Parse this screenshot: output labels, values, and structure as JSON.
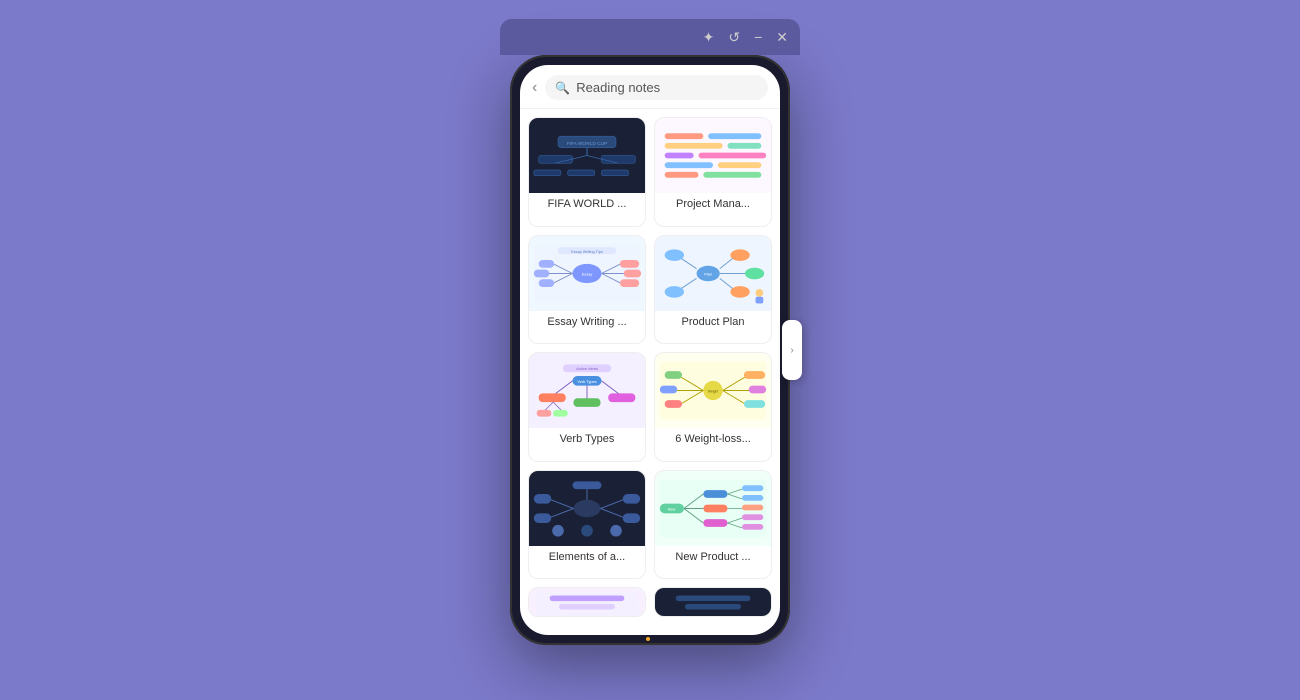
{
  "background_color": "#7b79c9",
  "titlebar": {
    "icons": [
      "star",
      "refresh",
      "minimize",
      "close"
    ],
    "bg_color": "#5c5a9e"
  },
  "search": {
    "placeholder": "Reading notes",
    "back_label": "‹"
  },
  "cards": [
    {
      "id": "fifa",
      "label": "FIFA WORLD ...",
      "theme": "dark"
    },
    {
      "id": "project-mana",
      "label": "Project Mana...",
      "theme": "light"
    },
    {
      "id": "essay-writing",
      "label": "Essay Writing ...",
      "theme": "light-blue"
    },
    {
      "id": "product-plan",
      "label": "Product Plan",
      "theme": "light-blue2"
    },
    {
      "id": "verb-types",
      "label": "Verb Types",
      "theme": "purple"
    },
    {
      "id": "weight-loss",
      "label": "6 Weight-loss...",
      "theme": "yellow"
    },
    {
      "id": "elements",
      "label": "Elements of a...",
      "theme": "dark"
    },
    {
      "id": "new-product",
      "label": "New Product ...",
      "theme": "teal"
    }
  ],
  "partial_cards": [
    {
      "id": "partial1",
      "label": ""
    },
    {
      "id": "partial2",
      "label": ""
    }
  ]
}
